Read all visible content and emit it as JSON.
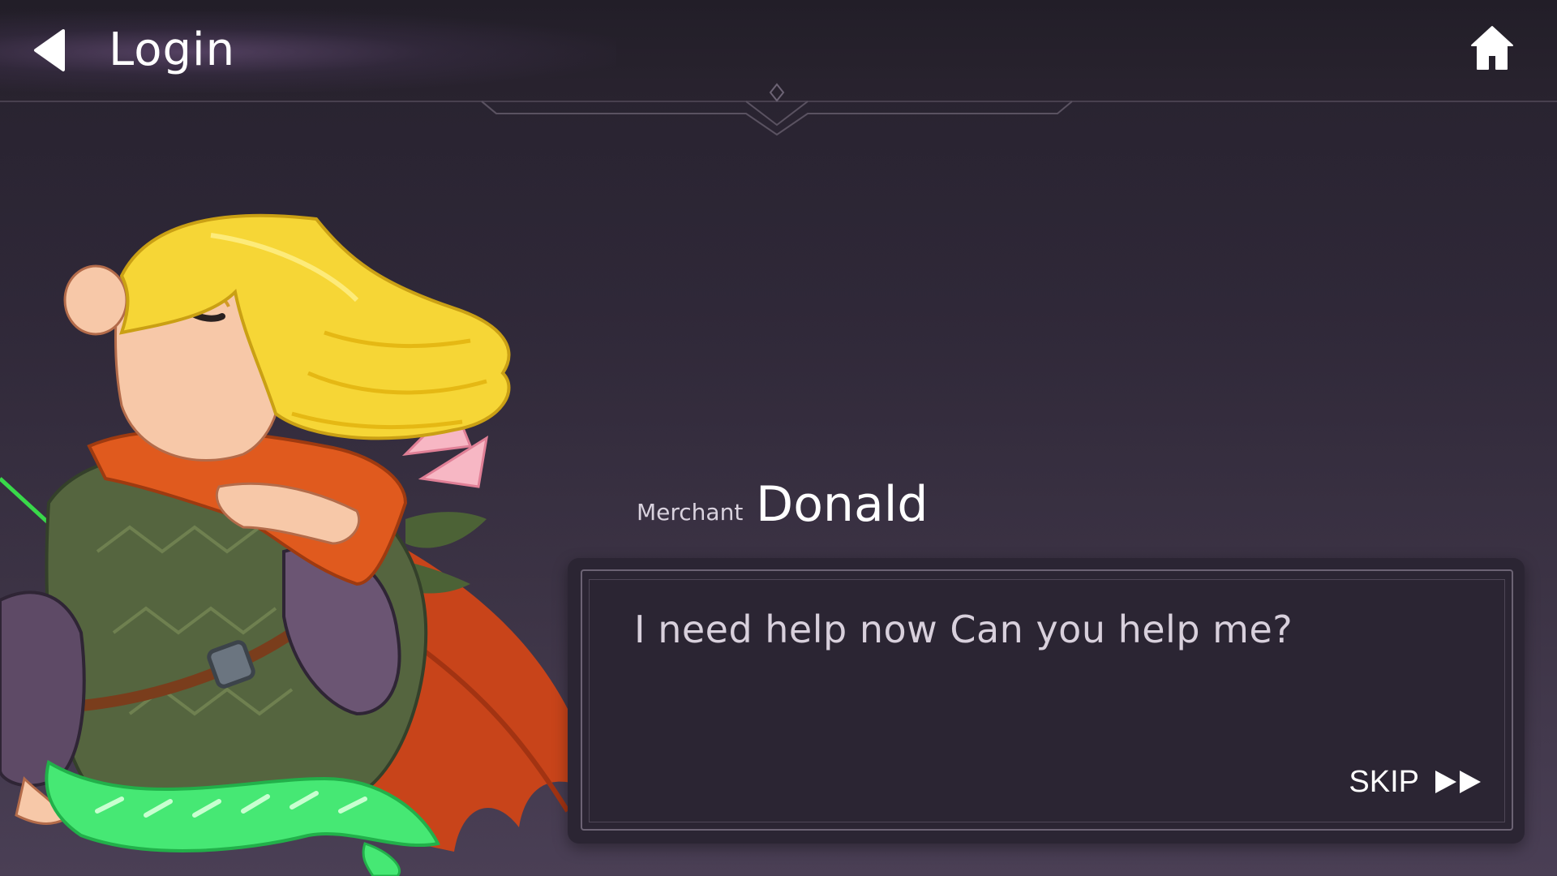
{
  "header": {
    "title": "Login",
    "back_icon": "back-arrow-icon",
    "home_icon": "home-icon"
  },
  "dialog": {
    "speaker_role": "Merchant",
    "speaker_name": "Donald",
    "message": "I need help now Can you help me?",
    "skip_label": "SKIP",
    "skip_icon": "fast-forward-icon"
  },
  "colors": {
    "background": "#2f2838",
    "dialog_background": "#2b2533",
    "dialog_border": "#6c6374",
    "text": "#d8d0dc",
    "hair": "#f7d93a",
    "scarf": "#e05a1e",
    "tunic": "#4f5e3e",
    "bow": "#3ee86a"
  }
}
